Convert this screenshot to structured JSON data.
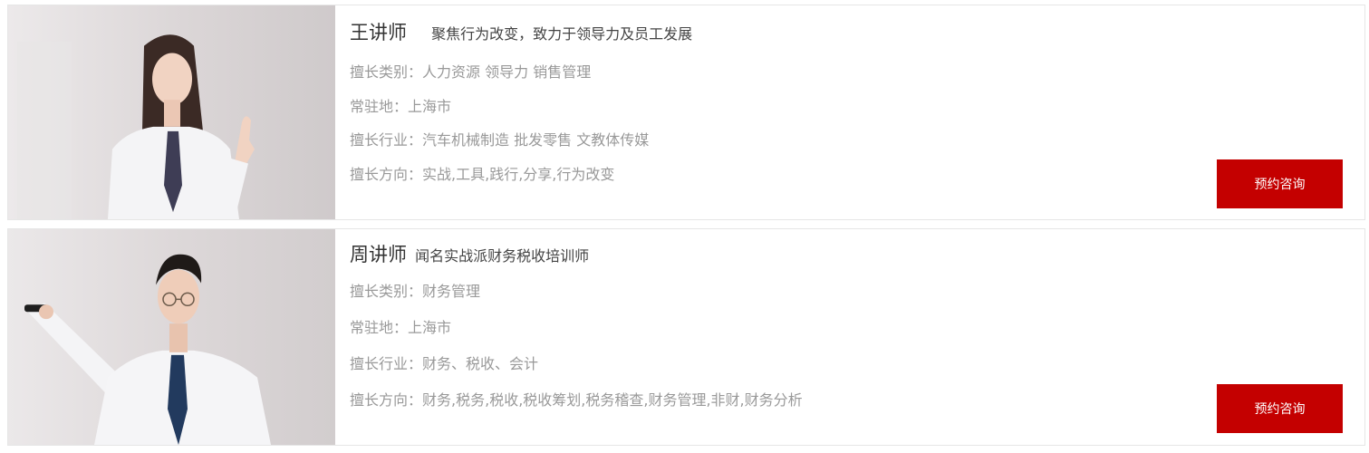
{
  "teachers": [
    {
      "name": "王讲师",
      "tagline": "聚焦行为改变，致力于领导力及员工发展",
      "category_label": "擅长类别：",
      "category": "人力资源 领导力 销售管理",
      "location_label": "常驻地：",
      "location": "上海市",
      "industry_label": "擅长行业：",
      "industry": "汽车机械制造 批发零售 文教体传媒",
      "direction_label": "擅长方向：",
      "direction": "实战,工具,践行,分享,行为改变",
      "button": "预约咨询"
    },
    {
      "name": "周讲师",
      "tagline": "闻名实战派财务税收培训师",
      "category_label": "擅长类别：",
      "category": "财务管理",
      "location_label": "常驻地：",
      "location": "上海市",
      "industry_label": "擅长行业：",
      "industry": "财务、税收、会计",
      "direction_label": "擅长方向：",
      "direction": "财务,税务,税收,税收筹划,税务稽查,财务管理,非财,财务分析",
      "button": "预约咨询"
    }
  ],
  "colors": {
    "accent": "#c40000",
    "muted_text": "#999999",
    "title_text": "#333333",
    "border": "#e6e6e6"
  }
}
